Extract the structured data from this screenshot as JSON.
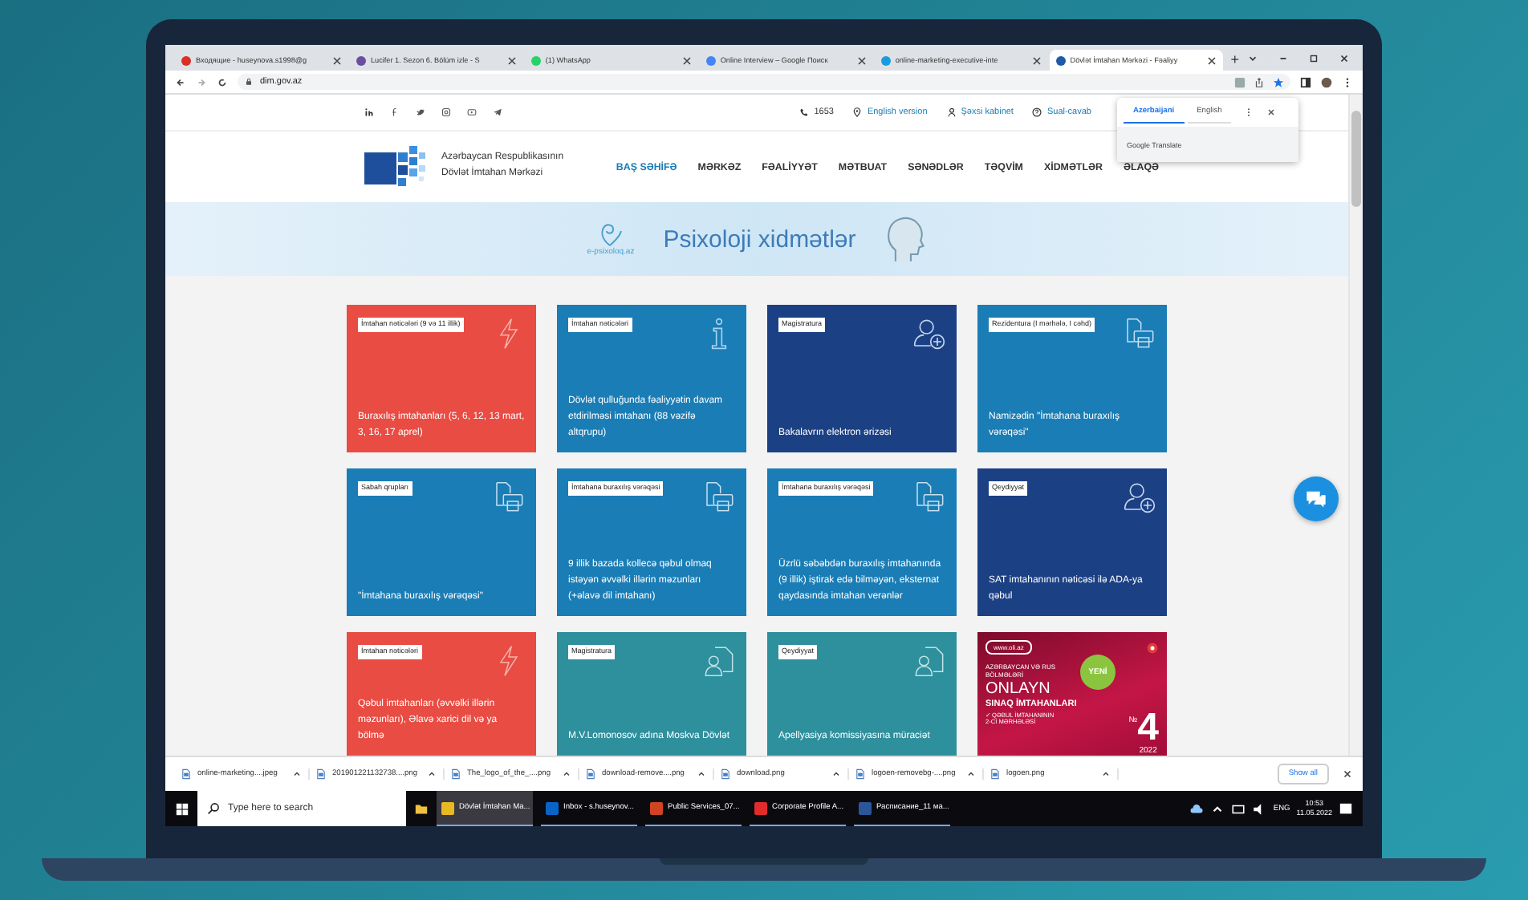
{
  "browser": {
    "tabs": [
      {
        "title": "Входящие - huseynova.s1998@g",
        "kind": "mail",
        "selected": false
      },
      {
        "title": "Lucifer 1. Sezon 6. Bölüm izle - S",
        "kind": "video",
        "selected": false
      },
      {
        "title": "(1) WhatsApp",
        "kind": "chat",
        "selected": false
      },
      {
        "title": "Online Interview – Google Поиск",
        "kind": "search",
        "selected": false
      },
      {
        "title": "online-marketing-executive-inte",
        "kind": "web",
        "selected": false
      },
      {
        "title": "Dövlət İmtahan Mərkəzi - Fəaliyy",
        "kind": "site",
        "selected": true
      }
    ],
    "new_tab": "+",
    "url": "dim.gov.az"
  },
  "site": {
    "top_bar": {
      "phone": "1653",
      "links": [
        {
          "label": "English version",
          "kind": "pin"
        },
        {
          "label": "Şəxsi kabinet",
          "kind": "user"
        },
        {
          "label": "Sual-cavab",
          "kind": "help"
        }
      ]
    },
    "translate_popup": {
      "languages": [
        {
          "label": "Azerbaijani",
          "selected": true
        },
        {
          "label": "English",
          "selected": false
        }
      ],
      "footer": "Google Translate"
    },
    "header": {
      "org_lines": [
        "Azərbaycan Respublikasının",
        "Dövlət İmtahan Mərkəzi"
      ],
      "nav": [
        {
          "label": "BAŞ SƏHİFƏ",
          "selected": true
        },
        {
          "label": "MƏRKƏZ",
          "selected": false
        },
        {
          "label": "FƏALİYYƏT",
          "selected": false
        },
        {
          "label": "MƏTBUAT",
          "selected": false
        },
        {
          "label": "SƏNƏDLƏR",
          "selected": false
        },
        {
          "label": "TƏQVİM",
          "selected": false
        },
        {
          "label": "XİDMƏTLƏR",
          "selected": false
        },
        {
          "label": "ƏLAQƏ",
          "selected": false
        }
      ]
    },
    "banner": {
      "site": "e-psixoloq.az",
      "title": "Psixoloji xidmətlər"
    },
    "tiles": [
      {
        "tag": "İmtahan nəticələri (9 və 11 illik)",
        "text": "Buraxılış imtahanları (5, 6, 12, 13 mart, 3, 16, 17 aprel)",
        "kind": "bolt",
        "color": "#e84c43"
      },
      {
        "tag": "İmtahan nəticələri",
        "text": "Dövlət qulluğunda fəaliyyətin davam etdirilməsi imtahanı (88 vəzifə altqrupu)",
        "kind": "info",
        "color": "#1a7db5"
      },
      {
        "tag": "Magistratura",
        "text": "Bakalavrın elektron ərizəsi",
        "kind": "person-add",
        "color": "#1b4084"
      },
      {
        "tag": "Rezidentura (I mərhələ, I cəhd)",
        "text": "Namizədin \"İmtahana buraxılış vərəqəsi\"",
        "kind": "printer",
        "color": "#1a7db5"
      },
      {
        "tag": "Sabah qrupları",
        "text": "\"İmtahana buraxılış vərəqəsi\"",
        "kind": "printer",
        "color": "#1a7db5"
      },
      {
        "tag": "İmtahana buraxılış vərəqəsi",
        "text": "9 illik bazada kollecə qəbul olmaq istəyən əvvəlki illərin məzunları (+əlavə dil imtahanı)",
        "kind": "printer",
        "color": "#1a7db5"
      },
      {
        "tag": "İmtahana buraxılış vərəqəsi",
        "text": "Üzrlü səbəbdən buraxılış imtahanında (9 illik) iştirak edə bilməyən, eksternat qaydasında imtahan verənlər",
        "kind": "printer",
        "color": "#1a7db5"
      },
      {
        "tag": "Qeydiyyat",
        "text": "SAT imtahanının nəticəsi ilə ADA-ya qəbul",
        "kind": "person-add",
        "color": "#1b4084"
      },
      {
        "tag": "İmtahan nəticələri",
        "text": "Qəbul imtahanları (əvvəlki illərin məzunları), Əlavə xarici dil və ya bölmə",
        "kind": "bolt",
        "color": "#e84c43"
      },
      {
        "tag": "Magistratura",
        "text": "M.V.Lomonosov adına Moskva Dövlət",
        "kind": "person-doc",
        "color": "#2e8f9d"
      },
      {
        "tag": "Qeydiyyat",
        "text": "Apellyasiya komissiyasına müraciət",
        "kind": "person-doc",
        "color": "#2e8f9d"
      }
    ],
    "promo": {
      "site": "www.oli.az",
      "sections": "AZƏRBAYCAN VƏ RUS BÖLMƏLƏRİ",
      "badge": "YENİ",
      "title": "ONLAYN",
      "subtitle": "SINAQ İMTAHANLARI",
      "points": [
        "✓ QƏBUL İMTAHANININ",
        "2-Cİ MƏRHƏLƏSİ"
      ],
      "number_sign": "№",
      "number": "4",
      "year": "2022"
    }
  },
  "downloads": {
    "items": [
      "online-marketing....jpeg",
      "201901221132738....png",
      "The_logo_of_the_....png",
      "download-remove....png",
      "download.png",
      "logoen-removebg-....png",
      "logoen.png"
    ],
    "show_all": "Show all"
  },
  "taskbar": {
    "search_placeholder": "Type here to search",
    "apps": [
      {
        "label": "Dövlət İmtahan Ma...",
        "kind": "browser",
        "selected": true
      },
      {
        "label": "Inbox - s.huseynov...",
        "kind": "mail",
        "selected": false
      },
      {
        "label": "Public Services_07...",
        "kind": "slides",
        "selected": false
      },
      {
        "label": "Corporate Profile A...",
        "kind": "pdf",
        "selected": false
      },
      {
        "label": "Расписание_11 ма...",
        "kind": "doc",
        "selected": false
      }
    ],
    "language": "ENG",
    "time": "10:53",
    "date": "11.05.2022"
  }
}
